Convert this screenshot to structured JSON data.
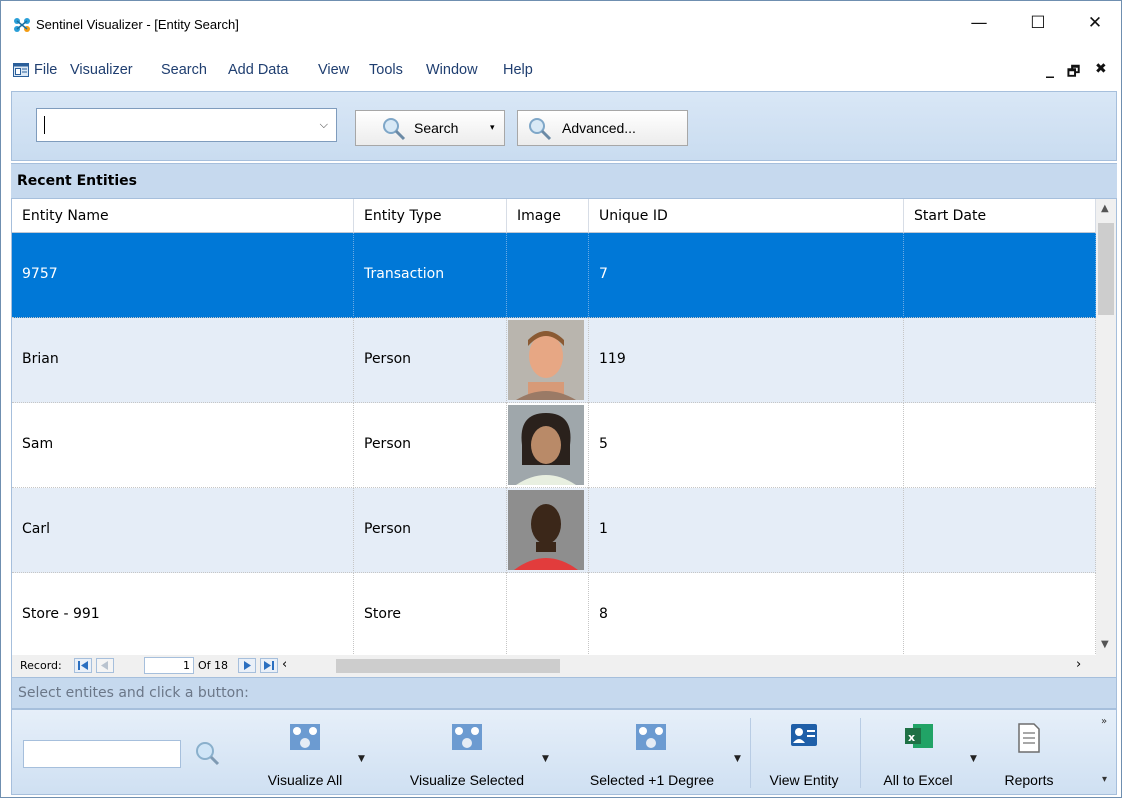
{
  "window": {
    "title": "Sentinel Visualizer - [Entity Search]",
    "minimize": "—",
    "maximize": "☐",
    "close": "✕"
  },
  "menu": {
    "items": [
      "File",
      "Visualizer",
      "Search",
      "Add Data",
      "View",
      "Tools",
      "Window",
      "Help"
    ],
    "mdi_minimize": "_",
    "mdi_restore": "🗗",
    "mdi_close": "✖"
  },
  "search": {
    "input_value": "",
    "search_label": "Search",
    "advanced_label": "Advanced..."
  },
  "section": {
    "title": "Recent Entities"
  },
  "grid": {
    "columns": [
      "Entity Name",
      "Entity Type",
      "Image",
      "Unique ID",
      "Start Date"
    ],
    "rows": [
      {
        "name": "9757",
        "type": "Transaction",
        "image": "",
        "id": "7",
        "start": ""
      },
      {
        "name": "Brian",
        "type": "Person",
        "image": "photo-1",
        "id": "119",
        "start": ""
      },
      {
        "name": "Sam",
        "type": "Person",
        "image": "photo-2",
        "id": "5",
        "start": ""
      },
      {
        "name": "Carl",
        "type": "Person",
        "image": "photo-3",
        "id": "1",
        "start": ""
      },
      {
        "name": "Store - 991",
        "type": "Store",
        "image": "",
        "id": "8",
        "start": ""
      }
    ],
    "selected_row": 0
  },
  "record_nav": {
    "label": "Record:",
    "current": "1",
    "of_text": "Of  18"
  },
  "status": {
    "text": "Select entites and click a button:"
  },
  "toolbar": {
    "search_value": "",
    "buttons": [
      "Visualize All",
      "Visualize Selected",
      "Selected +1 Degree",
      "View Entity",
      "All to Excel",
      "Reports"
    ]
  },
  "colors": {
    "selection": "#0078d7",
    "panel": "#c6d9ee",
    "menu_text": "#1f3e70",
    "excel_green": "#1e7145"
  }
}
